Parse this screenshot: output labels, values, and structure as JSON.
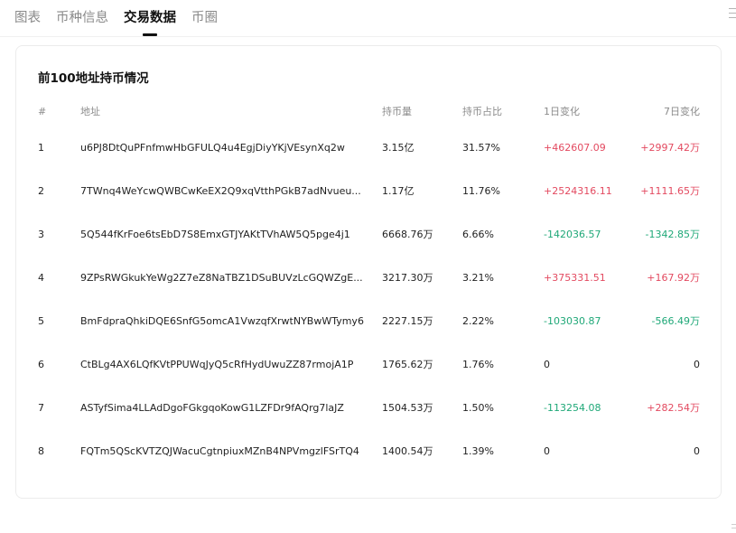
{
  "tabs": [
    {
      "label": "图表",
      "active": false
    },
    {
      "label": "币种信息",
      "active": false
    },
    {
      "label": "交易数据",
      "active": true
    },
    {
      "label": "币圈",
      "active": false
    }
  ],
  "card": {
    "title": "前100地址持币情况",
    "headers": {
      "rank": "#",
      "address": "地址",
      "amount": "持币量",
      "share": "持币占比",
      "change_1d": "1日变化",
      "change_7d": "7日变化"
    },
    "rows": [
      {
        "rank": "1",
        "address": "u6PJ8DtQuPFnfmwHbGFULQ4u4EgjDiyYKjVEsynXq2w",
        "amount": "3.15亿",
        "share": "31.57%",
        "d1": "+462607.09",
        "d1_dir": "up",
        "d7": "+2997.42万",
        "d7_dir": "up"
      },
      {
        "rank": "2",
        "address": "7TWnq4WeYcwQWBCwKeEX2Q9xqVtthPGkB7adNvueu...",
        "amount": "1.17亿",
        "share": "11.76%",
        "d1": "+2524316.11",
        "d1_dir": "up",
        "d7": "+1111.65万",
        "d7_dir": "up"
      },
      {
        "rank": "3",
        "address": "5Q544fKrFoe6tsEbD7S8EmxGTJYAKtTVhAW5Q5pge4j1",
        "amount": "6668.76万",
        "share": "6.66%",
        "d1": "-142036.57",
        "d1_dir": "down",
        "d7": "-1342.85万",
        "d7_dir": "down"
      },
      {
        "rank": "4",
        "address": "9ZPsRWGkukYeWg2Z7eZ8NaTBZ1DSuBUVzLcGQWZgE...",
        "amount": "3217.30万",
        "share": "3.21%",
        "d1": "+375331.51",
        "d1_dir": "up",
        "d7": "+167.92万",
        "d7_dir": "up"
      },
      {
        "rank": "5",
        "address": "BmFdpraQhkiDQE6SnfG5omcA1VwzqfXrwtNYBwWTymy6",
        "amount": "2227.15万",
        "share": "2.22%",
        "d1": "-103030.87",
        "d1_dir": "down",
        "d7": "-566.49万",
        "d7_dir": "down"
      },
      {
        "rank": "6",
        "address": "CtBLg4AX6LQfKVtPPUWqJyQ5cRfHydUwuZZ87rmojA1P",
        "amount": "1765.62万",
        "share": "1.76%",
        "d1": "0",
        "d1_dir": "flat",
        "d7": "0",
        "d7_dir": "flat"
      },
      {
        "rank": "7",
        "address": "ASTyfSima4LLAdDgoFGkgqoKowG1LZFDr9fAQrg7laJZ",
        "amount": "1504.53万",
        "share": "1.50%",
        "d1": "-113254.08",
        "d1_dir": "down",
        "d7": "+282.54万",
        "d7_dir": "up"
      },
      {
        "rank": "8",
        "address": "FQTm5QScKVTZQJWacuCgtnpiuxMZnB4NPVmgzlFSrTQ4",
        "amount": "1400.54万",
        "share": "1.39%",
        "d1": "0",
        "d1_dir": "flat",
        "d7": "0",
        "d7_dir": "flat"
      }
    ]
  }
}
